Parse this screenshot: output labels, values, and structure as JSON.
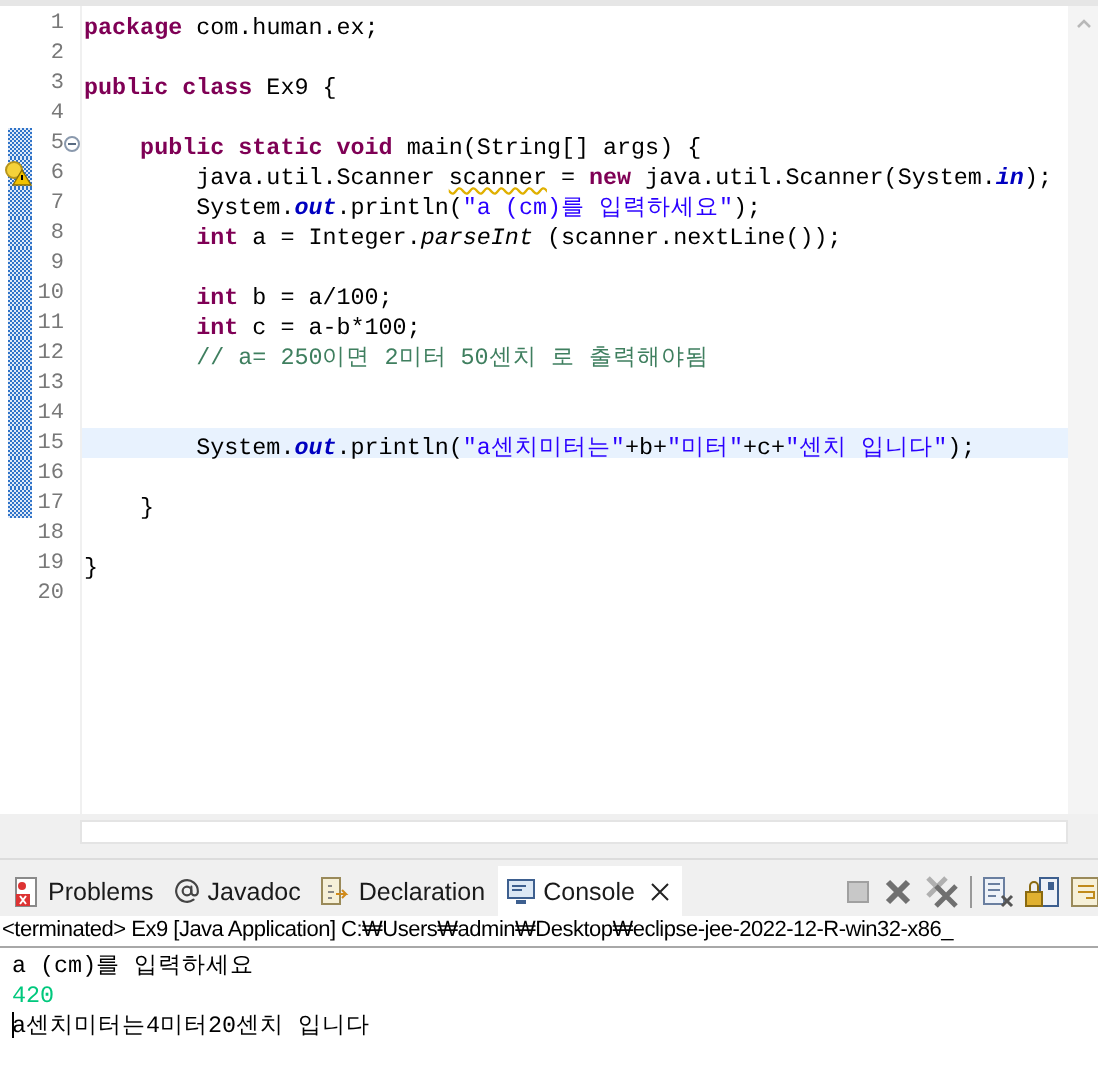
{
  "editor": {
    "lines": [
      {
        "number": "1",
        "changed": false,
        "current": false,
        "warning": false,
        "tokens": [
          {
            "kind": "kw",
            "text": "package"
          },
          {
            "kind": "text",
            "text": " com.human.ex;"
          }
        ]
      },
      {
        "number": "2",
        "changed": false,
        "current": false,
        "warning": false
      },
      {
        "number": "3",
        "changed": false,
        "current": false,
        "warning": false,
        "tokens": [
          {
            "kind": "kw",
            "text": "public class"
          },
          {
            "kind": "text",
            "text": " Ex9 {"
          }
        ]
      },
      {
        "number": "4",
        "changed": false,
        "current": false,
        "warning": false
      },
      {
        "number": "5",
        "changed": true,
        "current": false,
        "warning": false,
        "collapsed": false,
        "tokens": [
          {
            "kind": "kw",
            "text": "    public static void"
          },
          {
            "kind": "text",
            "text": " main(String[] args) {"
          }
        ]
      },
      {
        "number": "6",
        "changed": true,
        "current": false,
        "warning": true,
        "tokens": [
          {
            "kind": "text",
            "text": "        java.util.Scanner "
          },
          {
            "kind": "warn",
            "text": "scanner"
          },
          {
            "kind": "text",
            "text": " = "
          },
          {
            "kind": "kw",
            "text": "new"
          },
          {
            "kind": "text",
            "text": " java.util.Scanner(System."
          },
          {
            "kind": "field",
            "text": "in"
          },
          {
            "kind": "text",
            "text": ");"
          }
        ]
      },
      {
        "number": "7",
        "changed": true,
        "current": false,
        "warning": false,
        "tokens": [
          {
            "kind": "text",
            "text": "        System."
          },
          {
            "kind": "field",
            "text": "out"
          },
          {
            "kind": "text",
            "text": ".println("
          },
          {
            "kind": "str",
            "text": "\"a (cm)를 입력하세요\""
          },
          {
            "kind": "text",
            "text": ");"
          }
        ]
      },
      {
        "number": "8",
        "changed": true,
        "current": false,
        "warning": false,
        "tokens": [
          {
            "kind": "kw",
            "text": "        int"
          },
          {
            "kind": "text",
            "text": " a = Integer."
          },
          {
            "kind": "method",
            "text": "parseInt"
          },
          {
            "kind": "text",
            "text": " (scanner.nextLine());"
          }
        ]
      },
      {
        "number": "9",
        "changed": true,
        "current": false,
        "warning": false
      },
      {
        "number": "10",
        "changed": true,
        "current": false,
        "warning": false,
        "tokens": [
          {
            "kind": "kw",
            "text": "        int"
          },
          {
            "kind": "text",
            "text": " b = a/100;"
          }
        ]
      },
      {
        "number": "11",
        "changed": true,
        "current": false,
        "warning": false,
        "tokens": [
          {
            "kind": "kw",
            "text": "        int"
          },
          {
            "kind": "text",
            "text": " c = a-b*100;"
          }
        ]
      },
      {
        "number": "12",
        "changed": true,
        "current": false,
        "warning": false,
        "tokens": [
          {
            "kind": "comment",
            "text": "        // a= 250이면 2미터 50센치 로 출력해야됨"
          }
        ]
      },
      {
        "number": "13",
        "changed": true,
        "current": false,
        "warning": false
      },
      {
        "number": "14",
        "changed": true,
        "current": false,
        "warning": false
      },
      {
        "number": "15",
        "changed": true,
        "current": true,
        "warning": false,
        "tokens": [
          {
            "kind": "text",
            "text": "        System."
          },
          {
            "kind": "field",
            "text": "out"
          },
          {
            "kind": "text",
            "text": ".println("
          },
          {
            "kind": "str",
            "text": "\"a센치미터는\""
          },
          {
            "kind": "text",
            "text": "+b+"
          },
          {
            "kind": "str",
            "text": "\"미터\""
          },
          {
            "kind": "text",
            "text": "+c+"
          },
          {
            "kind": "str",
            "text": "\"센치 입니다\""
          },
          {
            "kind": "text",
            "text": ");"
          }
        ]
      },
      {
        "number": "16",
        "changed": true,
        "current": false,
        "warning": false
      },
      {
        "number": "17",
        "changed": true,
        "current": false,
        "warning": false,
        "tokens": [
          {
            "kind": "text",
            "text": "    }"
          }
        ]
      },
      {
        "number": "18",
        "changed": false,
        "current": false,
        "warning": false
      },
      {
        "number": "19",
        "changed": false,
        "current": false,
        "warning": false,
        "tokens": [
          {
            "kind": "text",
            "text": "}"
          }
        ]
      },
      {
        "number": "20",
        "changed": false,
        "current": false,
        "warning": false
      }
    ]
  },
  "panel": {
    "tabs": [
      {
        "kind": "problems",
        "label": "Problems",
        "selected": false
      },
      {
        "kind": "javadoc",
        "label": "Javadoc",
        "selected": false
      },
      {
        "kind": "declaration",
        "label": "Declaration",
        "selected": false
      },
      {
        "kind": "console",
        "label": "Console",
        "selected": true
      }
    ],
    "status": "<terminated> Ex9 [Java Application] C:₩Users₩admin₩Desktop₩eclipse-jee-2022-12-R-win32-x86_",
    "console": [
      {
        "kind": "output",
        "text": "a (cm)를 입력하세요",
        "cursor": false
      },
      {
        "kind": "input",
        "text": "420",
        "cursor": false
      },
      {
        "kind": "output",
        "text": "a센치미터는4미터20센치 입니다",
        "cursor": true
      }
    ]
  }
}
